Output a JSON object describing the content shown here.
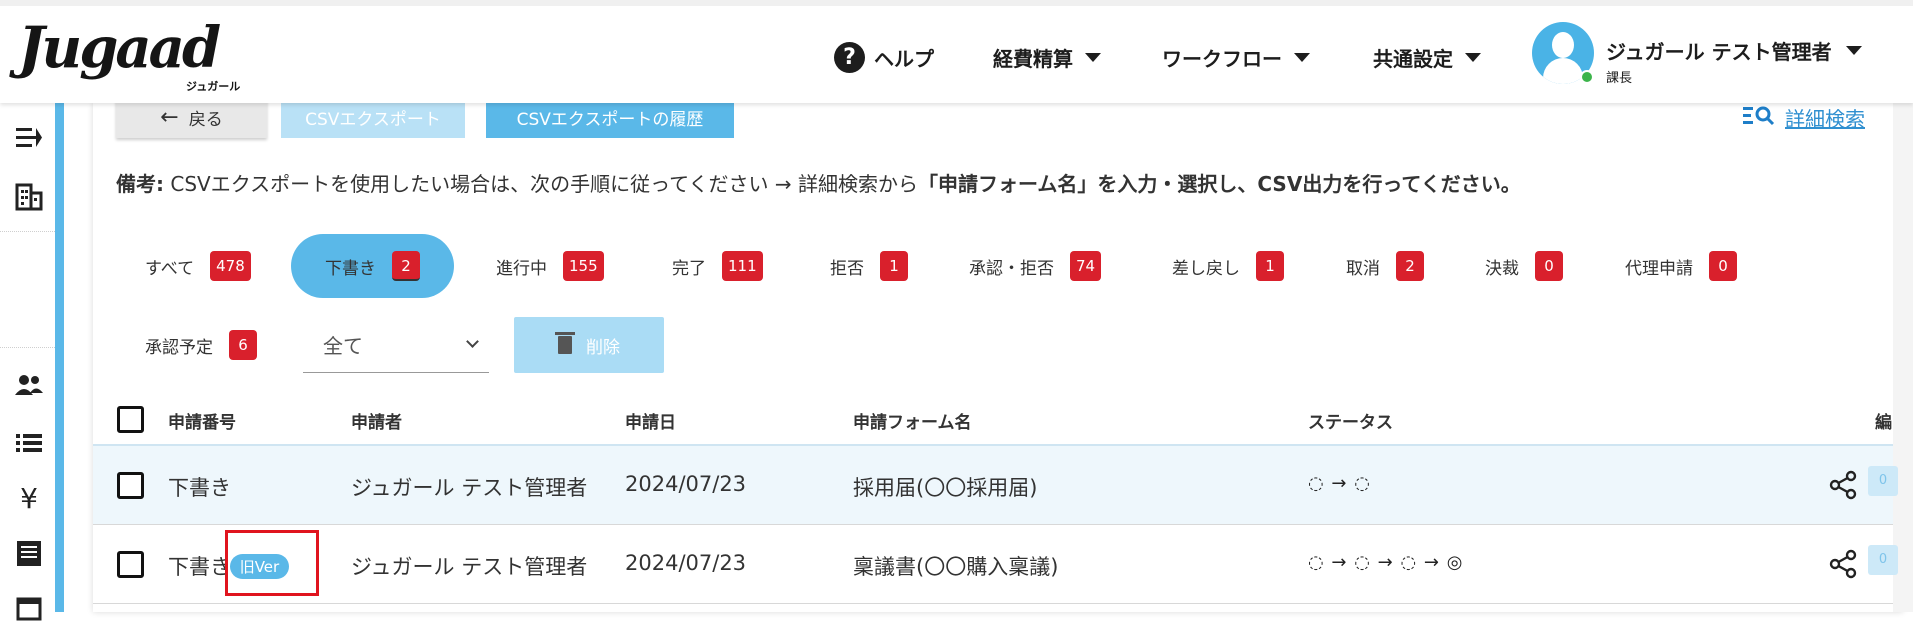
{
  "header": {
    "logo": "Jugaad",
    "logo_sub": "ジュガール",
    "help": "ヘルプ",
    "help_icon": "question-circle-icon",
    "menu_expense": "経費精算",
    "menu_workflow": "ワークフロー",
    "menu_common": "共通設定",
    "user_name": "ジュガール テスト管理者",
    "user_role": "課長"
  },
  "sidebar": {
    "icons": [
      "menu-collapse-icon",
      "building-icon",
      "users-icon",
      "list-icon",
      "yen-icon",
      "document-icon"
    ]
  },
  "toolbar": {
    "back_label": "戻る",
    "csv_export_label": "CSVエクスポート",
    "csv_history_label": "CSVエクスポートの履歴",
    "advanced_search_label": "詳細検索"
  },
  "note": {
    "prefix": "備考:",
    "text1": " CSVエクスポートを使用したい場合は、次の手順に従ってください → 詳細検索から",
    "bold": "「申請フォーム名」を入力・選択し、CSV出力を行ってください。"
  },
  "tabs": [
    {
      "label": "すべて",
      "count": "478"
    },
    {
      "label": "下書き",
      "count": "2"
    },
    {
      "label": "進行中",
      "count": "155"
    },
    {
      "label": "完了",
      "count": "111"
    },
    {
      "label": "拒否",
      "count": "1"
    },
    {
      "label": "承認・拒否",
      "count": "74"
    },
    {
      "label": "差し戻し",
      "count": "1"
    },
    {
      "label": "取消",
      "count": "2"
    },
    {
      "label": "決裁",
      "count": "0"
    },
    {
      "label": "代理申請",
      "count": "0"
    },
    {
      "label": "承認予定",
      "count": "6"
    }
  ],
  "filter": {
    "select_value": "全て",
    "delete_label": "削除"
  },
  "table": {
    "headers": {
      "number": "申請番号",
      "applicant": "申請者",
      "date": "申請日",
      "form": "申請フォーム名",
      "status": "ステータス",
      "edit": "編"
    },
    "rows": [
      {
        "number": "下書き",
        "badge": "",
        "applicant": "ジュガール テスト管理者",
        "date": "2024/07/23",
        "form": "採用届(〇〇採用届)",
        "status": "◌ → ◌",
        "comments": "0"
      },
      {
        "number": "下書き",
        "badge": "旧Ver",
        "applicant": "ジュガール テスト管理者",
        "date": "2024/07/23",
        "form": "稟議書(〇〇購入稟議)",
        "status": "◌ → ◌ → ◌ → ◎",
        "comments": "0"
      }
    ]
  },
  "colors": {
    "accent": "#5ab8e8",
    "badge_red": "#d9202c",
    "highlight_red": "#e0141e"
  }
}
